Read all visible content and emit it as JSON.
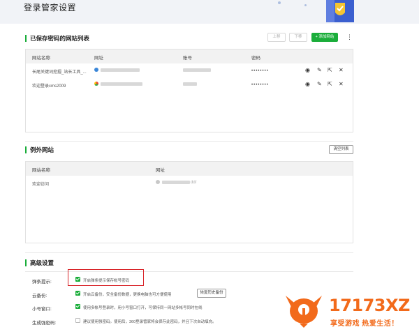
{
  "page": {
    "title": "登录管家设置"
  },
  "saved_sites": {
    "title": "已保存密码的网站列表",
    "btn_up": "上移",
    "btn_down": "下移",
    "btn_add": "+ 添加网站",
    "more_icon": "⋮",
    "columns": [
      "网站名称",
      "网址",
      "账号",
      "密码"
    ],
    "rows": [
      {
        "name": "长尾关键词挖掘_站长工具_...",
        "password": "••••••••",
        "icon": "site-globe-icon"
      },
      {
        "name": "欢迎登录cms2009",
        "password": "••••••••",
        "icon": "site-chrome-icon"
      }
    ],
    "actions": {
      "view": "◉",
      "edit": "✎",
      "open": "⇱",
      "delete": "✕"
    }
  },
  "exceptions": {
    "title": "例外网站",
    "btn_clear": "清空列表",
    "columns": [
      "网站名称",
      "网址"
    ],
    "rows": [
      {
        "name": "欢迎访问",
        "url_suffix": "dd/"
      }
    ]
  },
  "advanced": {
    "title": "高级设置",
    "settings": [
      {
        "label": "弹条提示:",
        "text": "开启弹条提示保存帐号密码",
        "checked": true
      },
      {
        "label": "云备份:",
        "text": "开启云备份，安全备份数据，更换电脑也可方便使用",
        "checked": true,
        "button": "恢复历史备份"
      },
      {
        "label": "小号窗口:",
        "text": "使用多帐号登录时，用小号窗口打开，可保持同一网站多帐号同时在线",
        "checked": true
      },
      {
        "label": "生成强密码:",
        "text": "建议使用强密码。使用后，360登录管家将会保存此密码，并且下次自动填充。",
        "checked": false
      }
    ]
  },
  "watermark": {
    "brand": "17173XZ",
    "slogan": "享受游戏 热爱生活！"
  },
  "colors": {
    "accent": "#1aad3a",
    "highlight": "#d9262b",
    "watermark": "#f26a1b"
  }
}
